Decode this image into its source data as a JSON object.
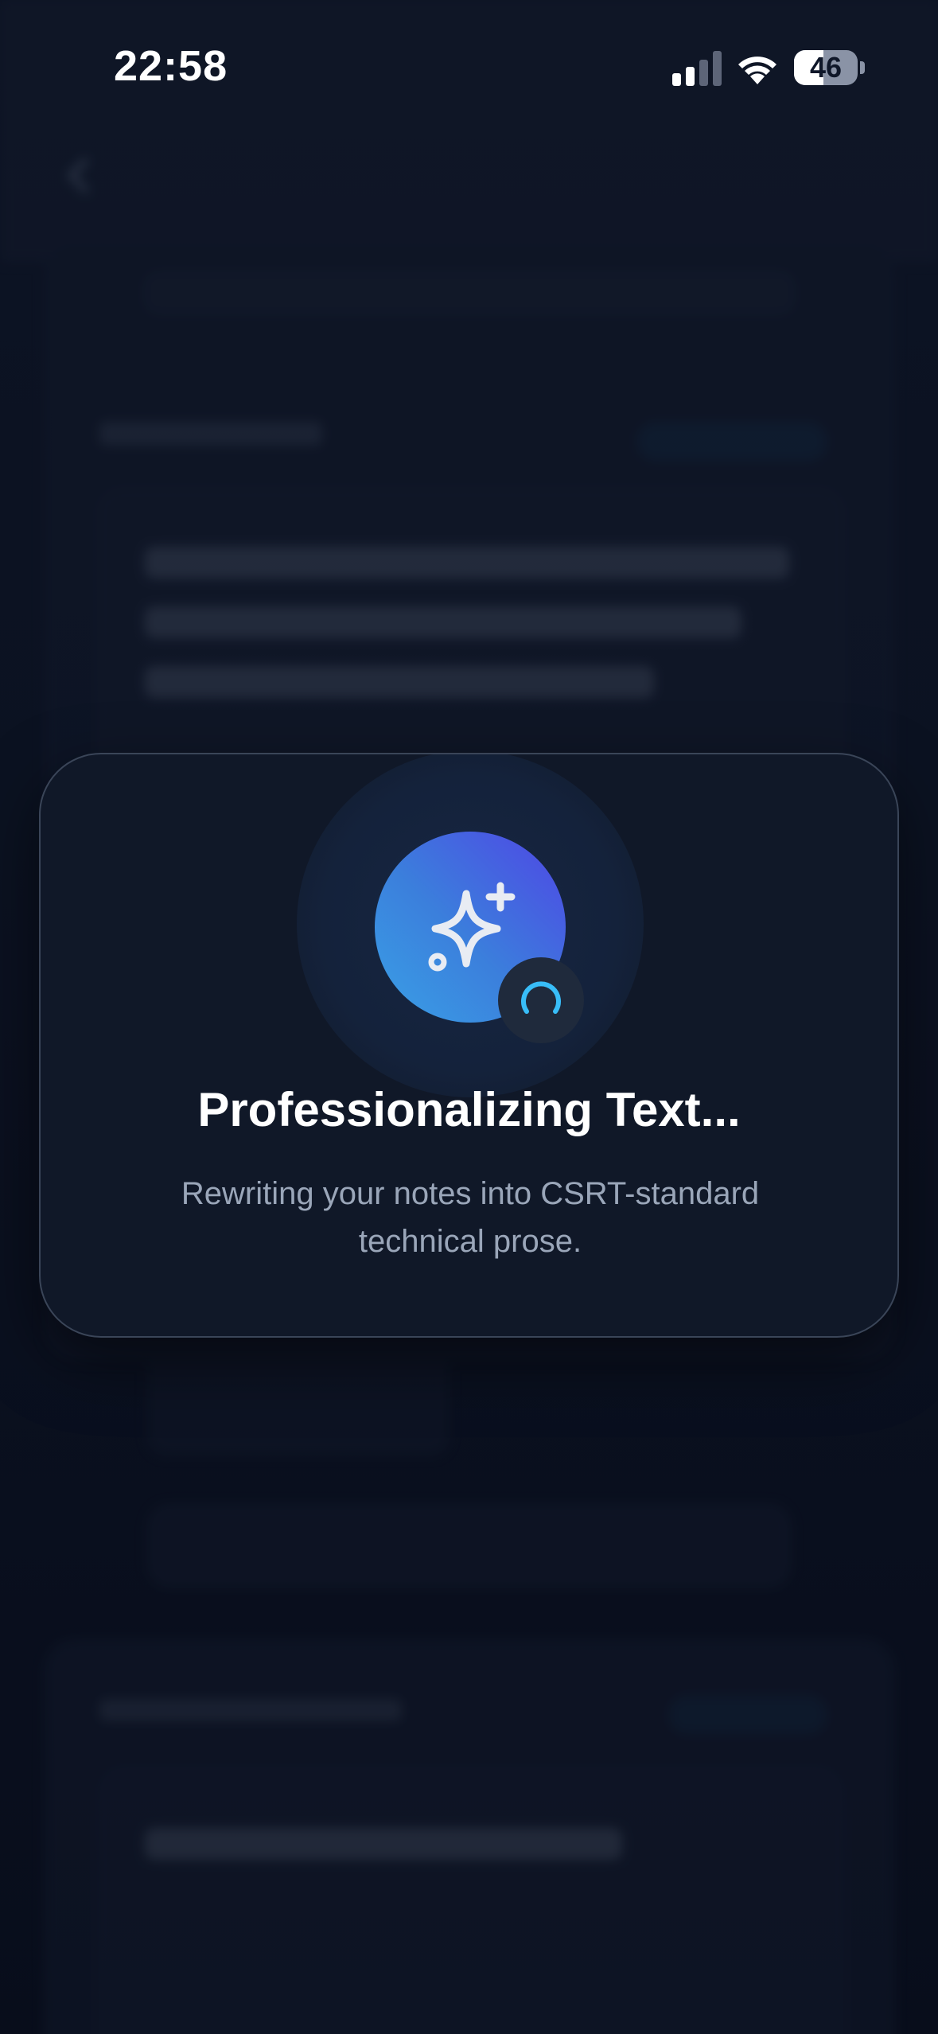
{
  "status_bar": {
    "time": "22:58",
    "battery_percent": "46",
    "battery_level": 0.46,
    "signal_bars_active": 2,
    "signal_bars_total": 4
  },
  "dialog": {
    "title": "Professionalizing Text...",
    "subtitle": "Rewriting your notes into CSRT-standard technical prose.",
    "main_icon": "sparkles-icon",
    "badge_icon": "spinner-icon"
  },
  "colors": {
    "accent_start": "#3aa0e6",
    "accent_end": "#4f46e5",
    "spinner": "#38bdf8"
  }
}
